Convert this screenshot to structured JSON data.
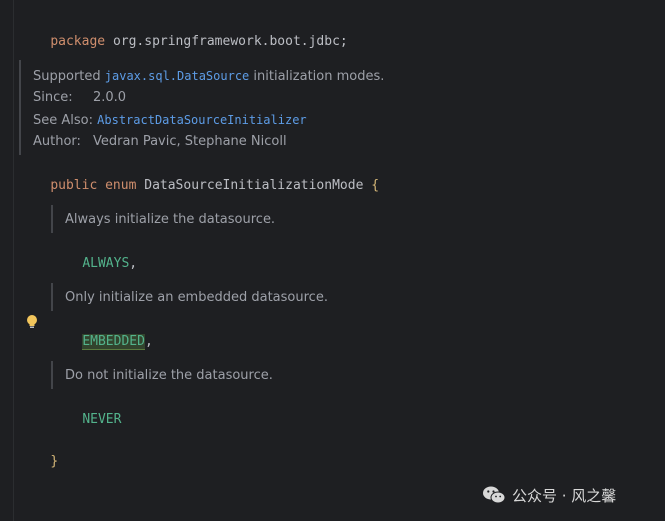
{
  "code": {
    "package_keyword": "package",
    "package_name": "org.springframework.boot.jdbc",
    "package_semicolon": ";",
    "public_keyword": "public",
    "enum_keyword": "enum",
    "enum_name": "DataSourceInitializationMode",
    "open_brace": "{",
    "close_brace": "}",
    "constants": [
      {
        "name": "ALWAYS",
        "suffix": ",",
        "doc": "Always initialize the datasource."
      },
      {
        "name": "EMBEDDED",
        "suffix": ",",
        "doc": "Only initialize an embedded datasource."
      },
      {
        "name": "NEVER",
        "suffix": "",
        "doc": "Do not initialize the datasource."
      }
    ]
  },
  "class_doc": {
    "summary_prefix": "Supported",
    "summary_code": "javax.sql.DataSource",
    "summary_suffix": "initialization modes.",
    "since_label": "Since:",
    "since_value": "2.0.0",
    "see_also_label": "See Also:",
    "see_also_value": "AbstractDataSourceInitializer",
    "author_label": "Author:",
    "author_value": "Vedran Pavic, Stephane Nicoll"
  },
  "icons": {
    "bulb": "lightbulb-icon",
    "watermark_logo": "wechat-icon"
  },
  "watermark": {
    "text": "公众号 · 风之馨"
  },
  "colors": {
    "background": "#1e1f22",
    "keyword": "#cf8e6d",
    "enum_constant": "#53b38c",
    "doc_text": "#9da0a8",
    "doc_link": "#5d9ce6",
    "brace": "#d5b778"
  }
}
